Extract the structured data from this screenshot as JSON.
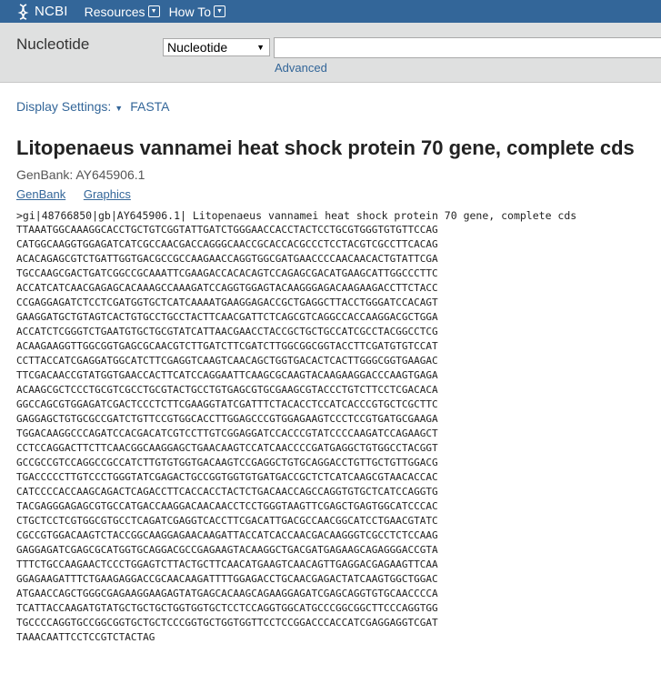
{
  "topbar": {
    "logo_text": "NCBI",
    "nav": [
      {
        "label": "Resources"
      },
      {
        "label": "How To"
      }
    ]
  },
  "search": {
    "db_label": "Nucleotide",
    "db_selected": "Nucleotide",
    "query_value": "",
    "advanced_label": "Advanced"
  },
  "display": {
    "settings_label": "Display Settings:",
    "format": "FASTA"
  },
  "record": {
    "title": "Litopenaeus vannamei heat shock protein 70 gene, complete cds",
    "accession_line": "GenBank: AY645906.1",
    "links": [
      {
        "label": "GenBank"
      },
      {
        "label": "Graphics"
      }
    ],
    "defline": ">gi|48766850|gb|AY645906.1| Litopenaeus vannamei heat shock protein 70 gene, complete cds",
    "sequence": [
      "TTAAATGGCAAAGGCACCTGCTGTCGGTATTGATCTGGGAACCACCTACTCCTGCGTGGGTGTGTTCCAG",
      "CATGGCAAGGTGGAGATCATCGCCAACGACCAGGGCAACCGCACCACGCCCTCCTACGTCGCCTTCACAG",
      "ACACAGAGCGTCTGATTGGTGACGCCGCCAAGAACCAGGTGGCGATGAACCCCAACAACACTGTATTCGA",
      "TGCCAAGCGACTGATCGGCCGCAAATTCGAAGACCACACAGTCCAGAGCGACATGAAGCATTGGCCCTTC",
      "ACCATCATCAACGAGAGCACAAAGCCAAAGATCCAGGTGGAGTACAAGGGAGACAAGAAGACCTTCTACC",
      "CCGAGGAGATCTCCTCGATGGTGCTCATCAAAATGAAGGAGACCGCTGAGGCTTACCTGGGATCCACAGT",
      "GAAGGATGCTGTAGTCACTGTGCCTGCCTACTTCAACGATTCTCAGCGTCAGGCCACCAAGGACGCTGGA",
      "ACCATCTCGGGTCTGAATGTGCTGCGTATCATTAACGAACCTACCGCTGCTGCCATCGCCTACGGCCTCG",
      "ACAAGAAGGTTGGCGGTGAGCGCAACGTCTTGATCTTCGATCTTGGCGGCGGTACCTTCGATGTGTCCAT",
      "CCTTACCATCGAGGATGGCATCTTCGAGGTCAAGTCAACAGCTGGTGACACTCACTTGGGCGGTGAAGAC",
      "TTCGACAACCGTATGGTGAACCACTTCATCCAGGAATTCAAGCGCAAGTACAAGAAGGACCCAAGTGAGA",
      "ACAAGCGCTCCCTGCGTCGCCTGCGTACTGCCTGTGAGCGTGCGAAGCGTACCCTGTCTTCCTCGACACA",
      "GGCCAGCGTGGAGATCGACTCCCTCTTCGAAGGTATCGATTTCTACACCTCCATCACCCGTGCTCGCTTC",
      "GAGGAGCTGTGCGCCGATCTGTTCCGTGGCACCTTGGAGCCCGTGGAGAAGTCCCTCCGTGATGCGAAGA",
      "TGGACAAGGCCCAGATCCACGACATCGTCCTTGTCGGAGGATCCACCCGTATCCCCAAGATCCAGAAGCT",
      "CCTCCAGGACTTCTTCAACGGCAAGGAGCTGAACAAGTCCATCAACCCCGATGAGGCTGTGGCCTACGGT",
      "GCCGCCGTCCAGGCCGCCATCTTGTGTGGTGACAAGTCCGAGGCTGTGCAGGACCTGTTGCTGTTGGACG",
      "TGACCCCCTTGTCCCTGGGTATCGAGACTGCCGGTGGTGTGATGACCGCTCTCATCAAGCGTAACACCAC",
      "CATCCCCACCAAGCAGACTCAGACCTTCACCACCTACTCTGACAACCAGCCAGGTGTGCTCATCCAGGTG",
      "TACGAGGGAGAGCGTGCCATGACCAAGGACAACAACCTCCTGGGTAAGTTCGAGCTGAGTGGCATCCCAC",
      "CTGCTCCTCGTGGCGTGCCTCAGATCGAGGTCACCTTCGACATTGACGCCAACGGCATCCTGAACGTATC",
      "CGCCGTGGACAAGTCTACCGGCAAGGAGAACAAGATTACCATCACCAACGACAAGGGTCGCCTCTCCAAG",
      "GAGGAGATCGAGCGCATGGTGCAGGACGCCGAGAAGTACAAGGCTGACGATGAGAAGCAGAGGGACCGTA",
      "TTTCTGCCAAGAACTCCCTGGAGTCTTACTGCTTCAACATGAAGTCAACAGTTGAGGACGAGAAGTTCAA",
      "GGAGAAGATTTCTGAAGAGGACCGCAACAAGATTTTGGAGACCTGCAACGAGACTATCAAGTGGCTGGAC",
      "ATGAACCAGCTGGGCGAGAAGGAAGAGTATGAGCACAAGCAGAAGGAGATCGAGCAGGTGTGCAACCCCA",
      "TCATTACCAAGATGTATGCTGCTGCTGGTGGTGCTCCTCCAGGTGGCATGCCCGGCGGCTTCCCAGGTGG",
      "TGCCCCAGGTGCCGGCGGTGCTGCTCCCGGTGCTGGTGGTTCCTCCGGACCCACCATCGAGGAGGTCGAT",
      "TAAACAATTCCTCCGTCTACTAG"
    ]
  }
}
